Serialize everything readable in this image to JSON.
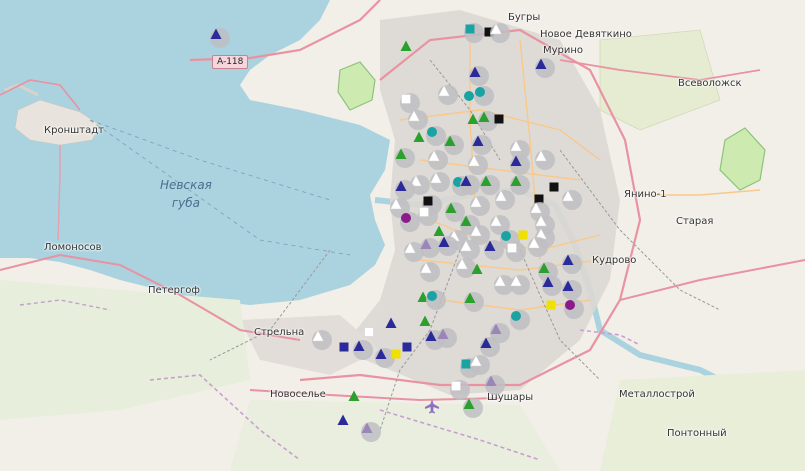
{
  "map": {
    "road_shield": "A-118",
    "places": [
      {
        "name": "Бугры"
      },
      {
        "name": "Новое Девяткино"
      },
      {
        "name": "Мурино"
      },
      {
        "name": "Всеволожск"
      },
      {
        "name": "Кронштадт"
      },
      {
        "name": "Янино-1"
      },
      {
        "name": "Старая"
      },
      {
        "name": "Ломоносов"
      },
      {
        "name": "Кудрово"
      },
      {
        "name": "Петергоф"
      },
      {
        "name": "Стрельна"
      },
      {
        "name": "Новоселье"
      },
      {
        "name": "Шушары"
      },
      {
        "name": "Металлострой"
      },
      {
        "name": "Понтонный"
      }
    ],
    "water_label": {
      "line1": "Невская",
      "line2": "губа"
    },
    "colors": {
      "water": "#aad3df",
      "land": "#f2efe9",
      "park": "#cdebb0",
      "urban": "#dcd7d3",
      "road_major": "#e892a2",
      "road_secondary": "#fcd6a4",
      "marker_halo": "#bebec3",
      "triangle_blue": "#2a2a9a",
      "triangle_green": "#2ca02c",
      "triangle_white": "#ffffff",
      "triangle_purple": "#9a87b8",
      "circle_teal": "#1aa3a3",
      "circle_purple": "#8b1a8b",
      "square_black": "#111111",
      "square_yellow": "#f0e000"
    }
  }
}
